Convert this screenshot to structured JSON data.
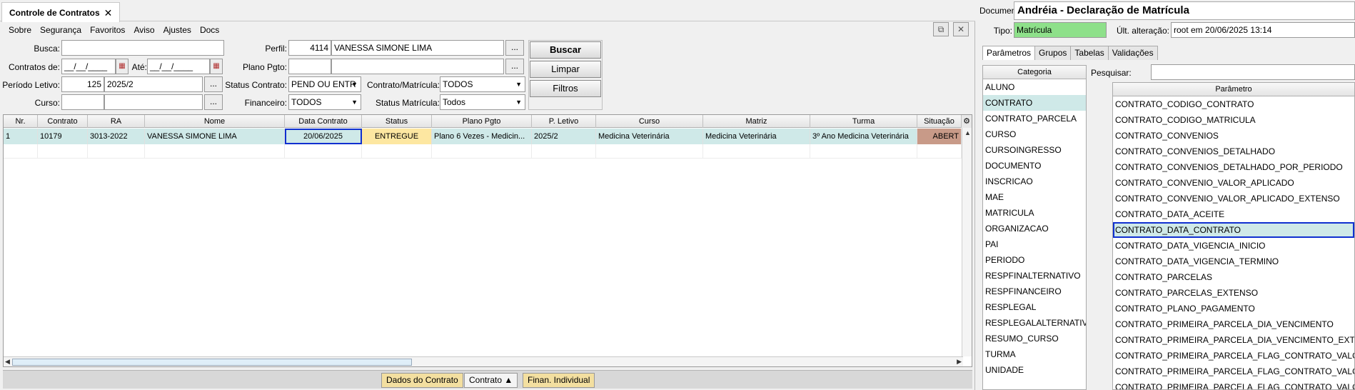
{
  "left": {
    "tab_title": "Controle de Contratos",
    "tab_close": "✕",
    "menu": [
      "Sobre",
      "Segurança",
      "Favoritos",
      "Aviso",
      "Ajustes",
      "Docs"
    ],
    "form": {
      "busca_label": "Busca:",
      "busca_value": "",
      "contratos_de_label": "Contratos de:",
      "contratos_de_value": "__/__/____",
      "ate_label": "Até:",
      "ate_value": "__/__/____",
      "periodo_label": "Período Letivo:",
      "periodo_code": "125",
      "periodo_value": "2025/2",
      "curso_label": "Curso:",
      "curso_code": "",
      "curso_value": "",
      "perfil_label": "Perfil:",
      "perfil_code": "4114",
      "perfil_value": "VANESSA SIMONE LIMA",
      "plano_label": "Plano Pgto:",
      "plano_code": "",
      "plano_value": "",
      "status_contrato_label": "Status Contrato:",
      "status_contrato_value": "PEND OU ENTR",
      "contrato_matricula_label": "Contrato/Matrícula:",
      "contrato_matricula_value": "TODOS",
      "financeiro_label": "Financeiro:",
      "financeiro_value": "TODOS",
      "status_matricula_label": "Status Matrícula:",
      "status_matricula_value": "Todos",
      "dots": "...",
      "buscar": "Buscar",
      "limpar": "Limpar",
      "filtros": "Filtros"
    },
    "grid": {
      "headers": [
        "Nr.",
        "Contrato",
        "RA",
        "Nome",
        "Data Contrato",
        "Status",
        "Plano Pgto",
        "P. Letivo",
        "Curso",
        "Matriz",
        "Turma",
        "Situação"
      ],
      "row": [
        "1",
        "10179",
        "3013-2022",
        "VANESSA SIMONE LIMA",
        "20/06/2025",
        "ENTREGUE",
        "Plano 6 Vezes - Medicin...",
        "2025/2",
        "Medicina Veterinária",
        "Medicina Veterinária",
        "3º Ano Medicina Veterinária",
        "ABERT"
      ]
    },
    "bottom": {
      "dados": "Dados do Contrato",
      "contrato": "Contrato ▲",
      "finan": "Finan. Individual"
    },
    "colors": {
      "selected_row": "#cfe9e8",
      "status_bg": "#fde7a1",
      "situacao_bg": "#c89a88",
      "highlight": "#1030d0"
    }
  },
  "right": {
    "documento_label": "Documento:",
    "documento_value": "Andréia - Declaração de Matrícula",
    "tipo_label": "Tipo:",
    "tipo_value": "Matrícula",
    "ult_label": "Últ. alteração:",
    "ult_value": "root em 20/06/2025 13:14",
    "tabs": [
      "Parâmetros",
      "Grupos",
      "Tabelas",
      "Validações"
    ],
    "categoria_header": "Categoria",
    "categorias": [
      "ALUNO",
      "CONTRATO",
      "CONTRATO_PARCELA",
      "CURSO",
      "CURSOINGRESSO",
      "DOCUMENTO",
      "INSCRICAO",
      "MAE",
      "MATRICULA",
      "ORGANIZACAO",
      "PAI",
      "PERIODO",
      "RESPFINALTERNATIVO",
      "RESPFINANCEIRO",
      "RESPLEGAL",
      "RESPLEGALALTERNATIVO",
      "RESUMO_CURSO",
      "TURMA",
      "UNIDADE"
    ],
    "pesquisar_label": "Pesquisar:",
    "pesquisar_value": "",
    "parametro_header": "Parâmetro",
    "parametros": [
      "CONTRATO_CODIGO_CONTRATO",
      "CONTRATO_CODIGO_MATRICULA",
      "CONTRATO_CONVENIOS",
      "CONTRATO_CONVENIOS_DETALHADO",
      "CONTRATO_CONVENIOS_DETALHADO_POR_PERIODO",
      "CONTRATO_CONVENIO_VALOR_APLICADO",
      "CONTRATO_CONVENIO_VALOR_APLICADO_EXTENSO",
      "CONTRATO_DATA_ACEITE",
      "CONTRATO_DATA_CONTRATO",
      "CONTRATO_DATA_VIGENCIA_INICIO",
      "CONTRATO_DATA_VIGENCIA_TERMINO",
      "CONTRATO_PARCELAS",
      "CONTRATO_PARCELAS_EXTENSO",
      "CONTRATO_PLANO_PAGAMENTO",
      "CONTRATO_PRIMEIRA_PARCELA_DIA_VENCIMENTO",
      "CONTRATO_PRIMEIRA_PARCELA_DIA_VENCIMENTO_EXTENSO",
      "CONTRATO_PRIMEIRA_PARCELA_FLAG_CONTRATO_VALOR",
      "CONTRATO_PRIMEIRA_PARCELA_FLAG_CONTRATO_VALOR_...",
      "CONTRATO_PRIMEIRA_PARCELA_FLAG_CONTRATO_VALOR"
    ],
    "colors": {
      "tipo_bg": "#8ee08a"
    }
  }
}
